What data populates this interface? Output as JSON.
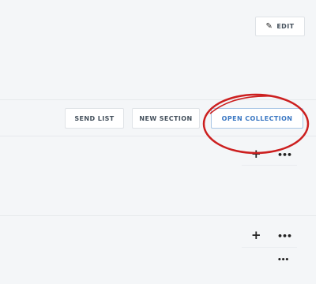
{
  "header": {
    "edit_label": "EDIT",
    "edit_icon": "pencil-icon"
  },
  "toolbar": {
    "send_list_label": "SEND LIST",
    "new_section_label": "NEW SECTION",
    "open_collection_label": "OPEN COLLECTION"
  },
  "rows": [
    {
      "add_icon": "plus-icon",
      "more_icon": "ellipsis-icon"
    },
    {
      "add_icon": "plus-icon",
      "more_icon": "ellipsis-icon"
    },
    {
      "more_icon": "ellipsis-icon"
    }
  ],
  "colors": {
    "panel_background": "#f4f6f8",
    "button_border": "#dfe3e7",
    "primary_text": "#3b78c3",
    "highlight_ellipse": "#cc1f1f"
  }
}
